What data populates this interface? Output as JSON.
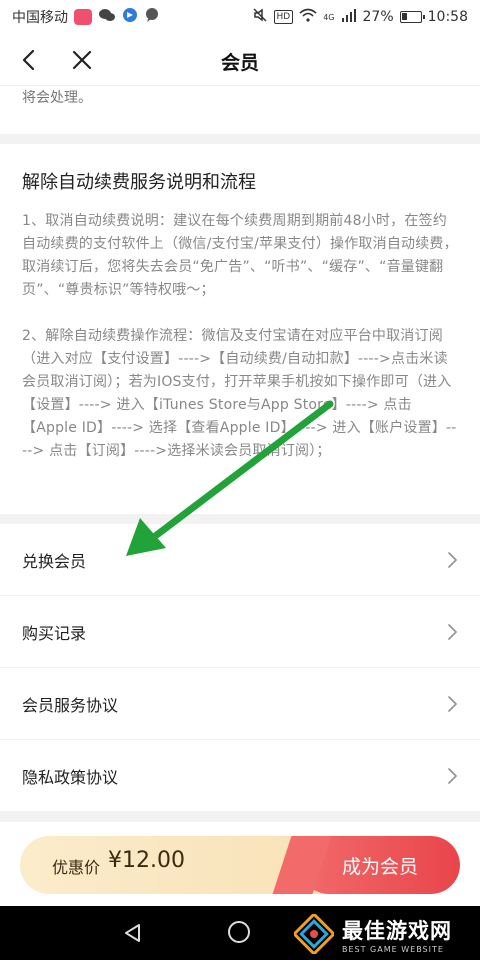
{
  "status_bar": {
    "carrier": "中国移动",
    "network": "4G",
    "battery": "27%",
    "time": "10:58",
    "hd_badge": "HD"
  },
  "nav": {
    "title": "会员"
  },
  "top_card": {
    "text_tail": "将会处理。"
  },
  "info": {
    "title": "解除自动续费服务说明和流程",
    "para1": "1、取消自动续费说明：建议在每个续费周期到期前48小时，在签约自动续费的支付软件上（微信/支付宝/苹果支付）操作取消自动续费，取消续订后，您将失去会员“免广告”、“听书”、“缓存”、“音量键翻页”、“尊贵标识”等特权哦～；",
    "para2": "2、解除自动续费操作流程：微信及支付宝请在对应平台中取消订阅（进入对应【支付设置】---->【自动续费/自动扣款】---->点击米读会员取消订阅）；若为IOS支付，打开苹果手机按如下操作即可（进入【设置】----> 进入【iTunes Store与App Store】----> 点击【Apple ID】----> 选择【查看Apple ID】----> 进入【账户设置】----> 点击【订阅】---->选择米读会员取消订阅）；"
  },
  "menu": {
    "items": [
      {
        "label": "兑换会员"
      },
      {
        "label": "购买记录"
      },
      {
        "label": "会员服务协议"
      },
      {
        "label": "隐私政策协议"
      }
    ]
  },
  "purchase": {
    "price_label": "优惠价",
    "price_value": "¥12.00",
    "button_label": "成为会员"
  },
  "watermark": {
    "main": "最佳游戏网",
    "sub": "BEST GAME WEBSITE"
  },
  "icons": {
    "back": "back-arrow-icon",
    "close": "close-icon",
    "chevron": "chevron-right-icon",
    "annotation": "green-arrow-annotation"
  },
  "colors": {
    "accent_red": "#e8454b",
    "gold_bar": "#f7ddb0",
    "annotation_green": "#22a33a"
  }
}
